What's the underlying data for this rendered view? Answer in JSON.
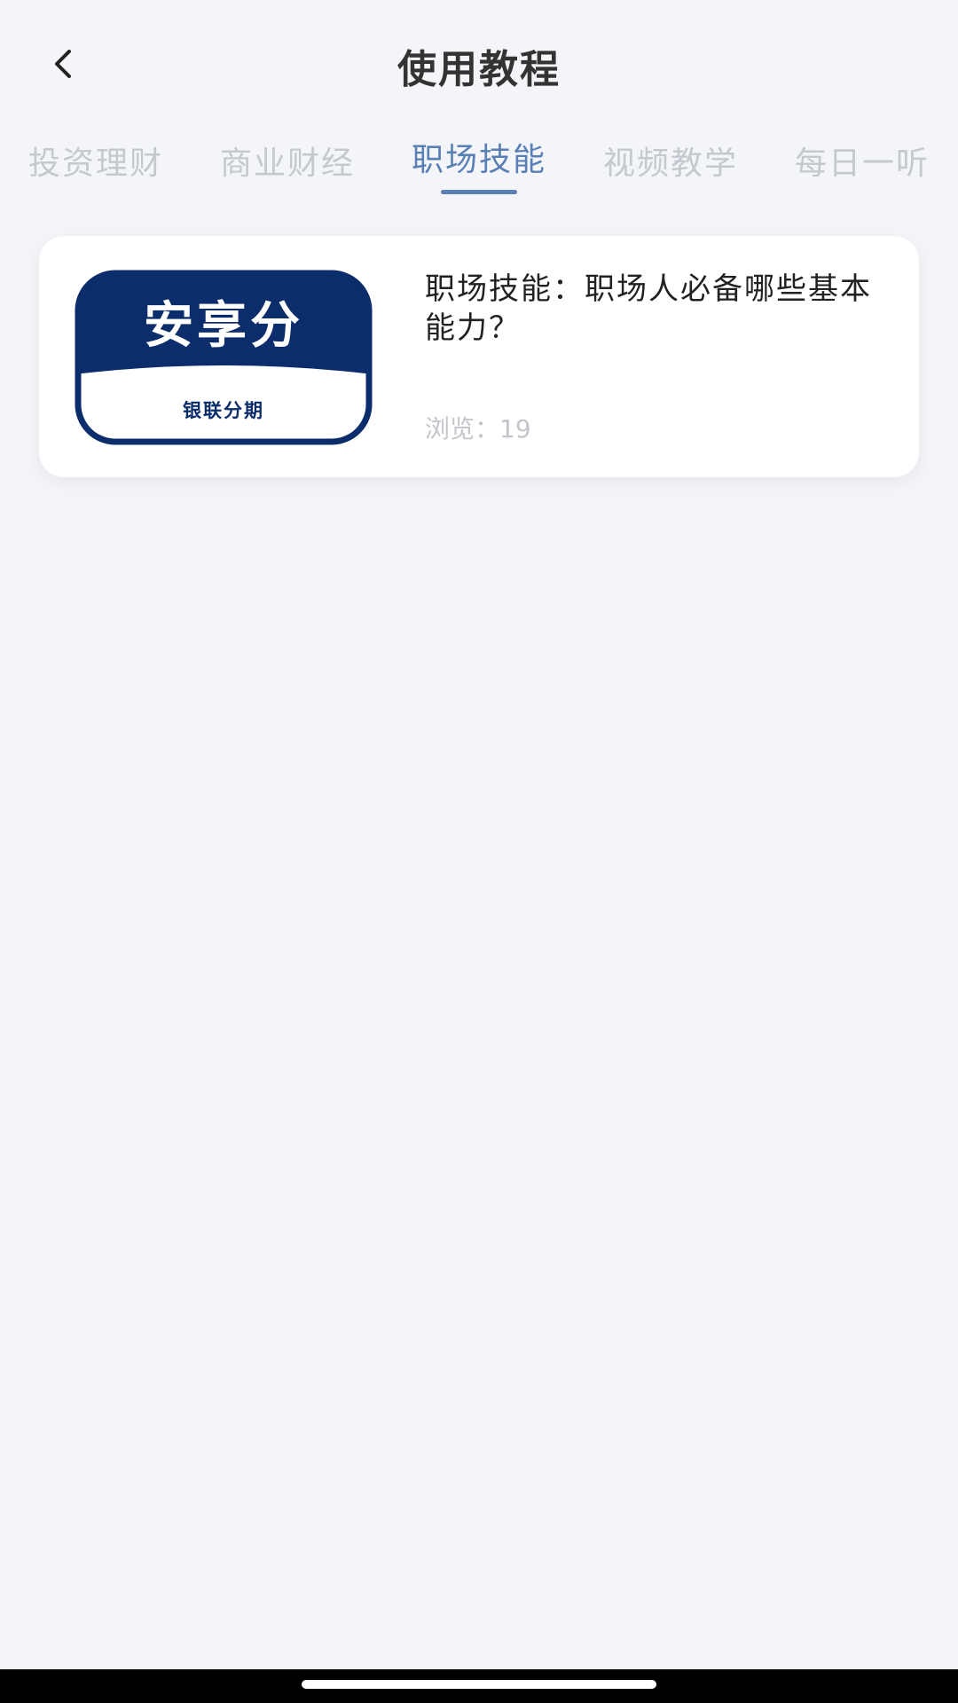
{
  "header": {
    "title": "使用教程",
    "back_icon": "chevron-left-icon"
  },
  "tabs": [
    {
      "label": "投资理财",
      "active": false
    },
    {
      "label": "商业财经",
      "active": false
    },
    {
      "label": "职场技能",
      "active": true
    },
    {
      "label": "视频教学",
      "active": false
    },
    {
      "label": "每日一听",
      "active": false
    }
  ],
  "colors": {
    "accent": "#5a7fb5",
    "background": "#f3f5f8",
    "brand_navy": "#0c2d6b"
  },
  "articles": [
    {
      "title": "职场技能：职场人必备哪些基本能力？",
      "views_label": "浏览：",
      "views": "19",
      "thumbnail": {
        "brand": "安享分",
        "subtitle": "银联分期"
      }
    }
  ]
}
